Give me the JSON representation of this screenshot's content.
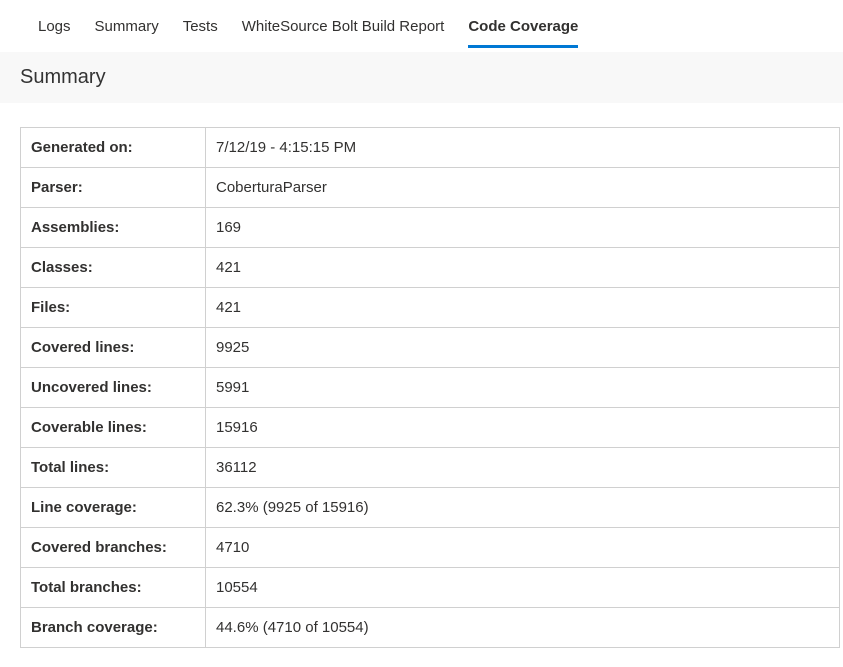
{
  "tabs": [
    {
      "label": "Logs",
      "active": false
    },
    {
      "label": "Summary",
      "active": false
    },
    {
      "label": "Tests",
      "active": false
    },
    {
      "label": "WhiteSource Bolt Build Report",
      "active": false
    },
    {
      "label": "Code Coverage",
      "active": true
    }
  ],
  "section_heading": "Summary",
  "rows": [
    {
      "label": "Generated on:",
      "value": "7/12/19 - 4:15:15 PM"
    },
    {
      "label": "Parser:",
      "value": "CoberturaParser"
    },
    {
      "label": "Assemblies:",
      "value": "169"
    },
    {
      "label": "Classes:",
      "value": "421"
    },
    {
      "label": "Files:",
      "value": "421"
    },
    {
      "label": "Covered lines:",
      "value": "9925"
    },
    {
      "label": "Uncovered lines:",
      "value": "5991"
    },
    {
      "label": "Coverable lines:",
      "value": "15916"
    },
    {
      "label": "Total lines:",
      "value": "36112"
    },
    {
      "label": "Line coverage:",
      "value": "62.3% (9925 of 15916)"
    },
    {
      "label": "Covered branches:",
      "value": "4710"
    },
    {
      "label": "Total branches:",
      "value": "10554"
    },
    {
      "label": "Branch coverage:",
      "value": "44.6% (4710 of 10554)"
    }
  ]
}
